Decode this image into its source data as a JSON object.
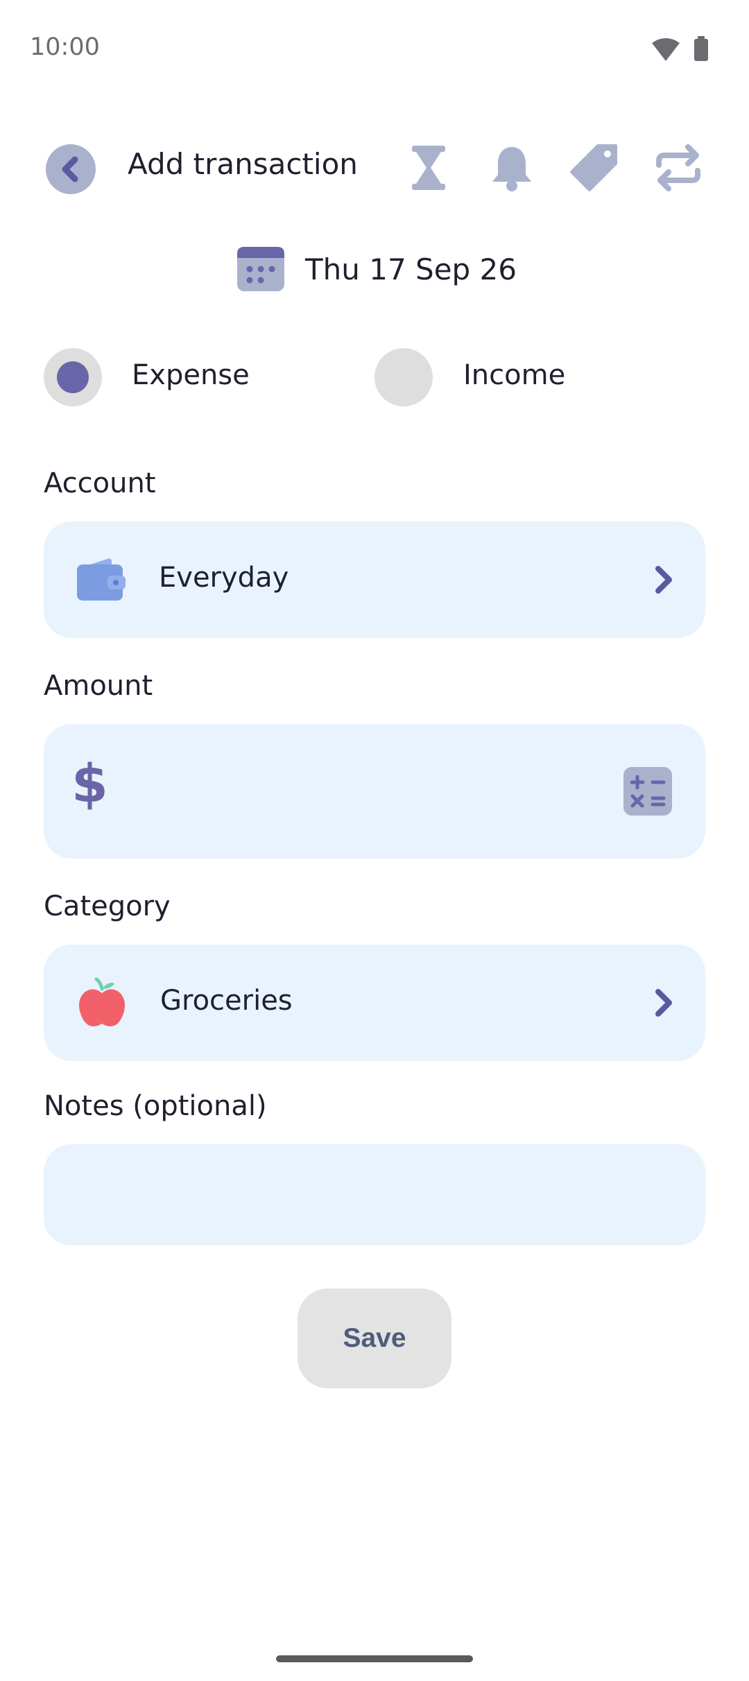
{
  "status_bar": {
    "time": "10:00",
    "icons": [
      "wifi-icon",
      "battery-icon"
    ]
  },
  "header": {
    "title": "Add transaction",
    "icons": [
      "back-arrow-icon",
      "hourglass-icon",
      "bell-icon",
      "tag-icon",
      "repeat-icon"
    ]
  },
  "date": {
    "label": "Thu 17 Sep 26",
    "icon": "calendar-icon"
  },
  "type": {
    "options": [
      {
        "label": "Expense",
        "selected": true
      },
      {
        "label": "Income",
        "selected": false
      }
    ]
  },
  "account": {
    "label": "Account",
    "value": "Everyday",
    "icon": "wallet-icon"
  },
  "amount": {
    "label": "Amount",
    "currency_symbol": "$",
    "value": "",
    "icon": "calculator-icon"
  },
  "category": {
    "label": "Category",
    "value": "Groceries",
    "icon": "apple-icon"
  },
  "notes": {
    "label": "Notes (optional)",
    "value": ""
  },
  "save": {
    "label": "Save"
  },
  "colors": {
    "accent": "#6a65a8",
    "icon_muted": "#a9b1cd",
    "field_bg": "#e8f3fd",
    "apple_red": "#f2616a",
    "wallet_blue": "#7b9ce0"
  }
}
